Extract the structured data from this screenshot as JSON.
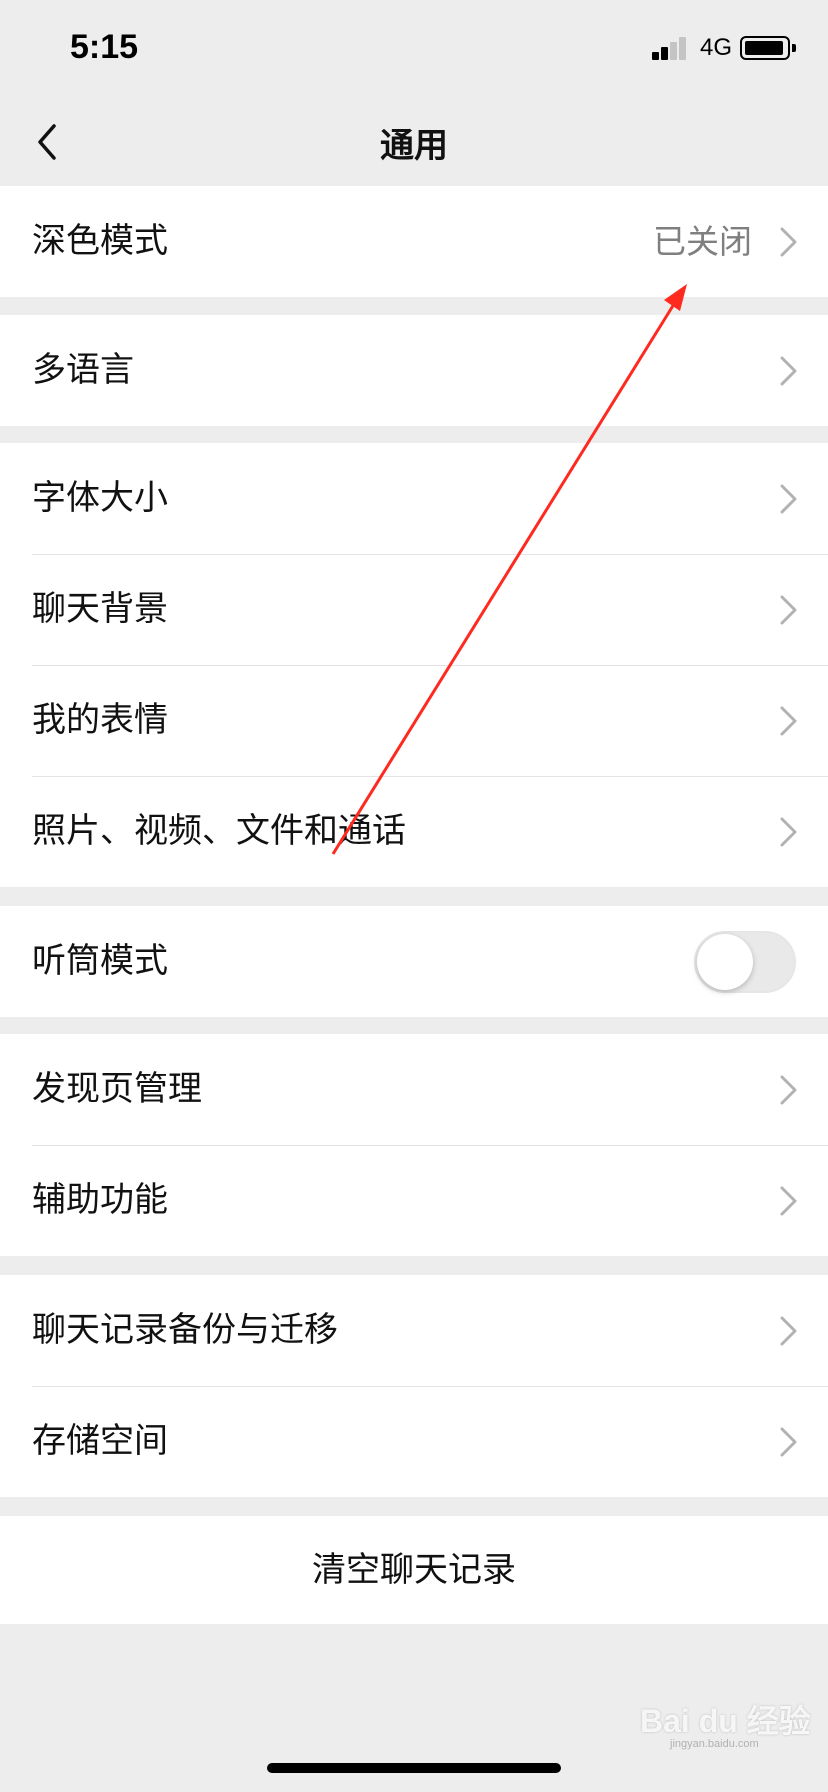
{
  "status_bar": {
    "time": "5:15",
    "network": "4G",
    "signal_bars": 2,
    "battery_level": 0.85
  },
  "nav": {
    "title": "通用",
    "back_icon": "chevron-left-icon"
  },
  "groups": [
    [
      {
        "label": "深色模式",
        "value": "已关闭"
      }
    ],
    [
      {
        "label": "多语言"
      }
    ],
    [
      {
        "label": "字体大小"
      },
      {
        "label": "聊天背景"
      },
      {
        "label": "我的表情"
      },
      {
        "label": "照片、视频、文件和通话"
      }
    ],
    [
      {
        "label": "听筒模式",
        "toggle": false
      }
    ],
    [
      {
        "label": "发现页管理"
      },
      {
        "label": "辅助功能"
      }
    ],
    [
      {
        "label": "聊天记录备份与迁移"
      },
      {
        "label": "存储空间"
      }
    ]
  ],
  "clear_history": {
    "label": "清空聊天记录"
  },
  "annotation": {
    "color": "#ff2a1f"
  },
  "watermark": {
    "text": "Bai du 经验",
    "sub": "jingyan.baidu.com"
  },
  "colors": {
    "background": "#ededed",
    "cell": "#ffffff",
    "value_text": "#7f7f7f",
    "chevron": "#b2b2b2"
  }
}
